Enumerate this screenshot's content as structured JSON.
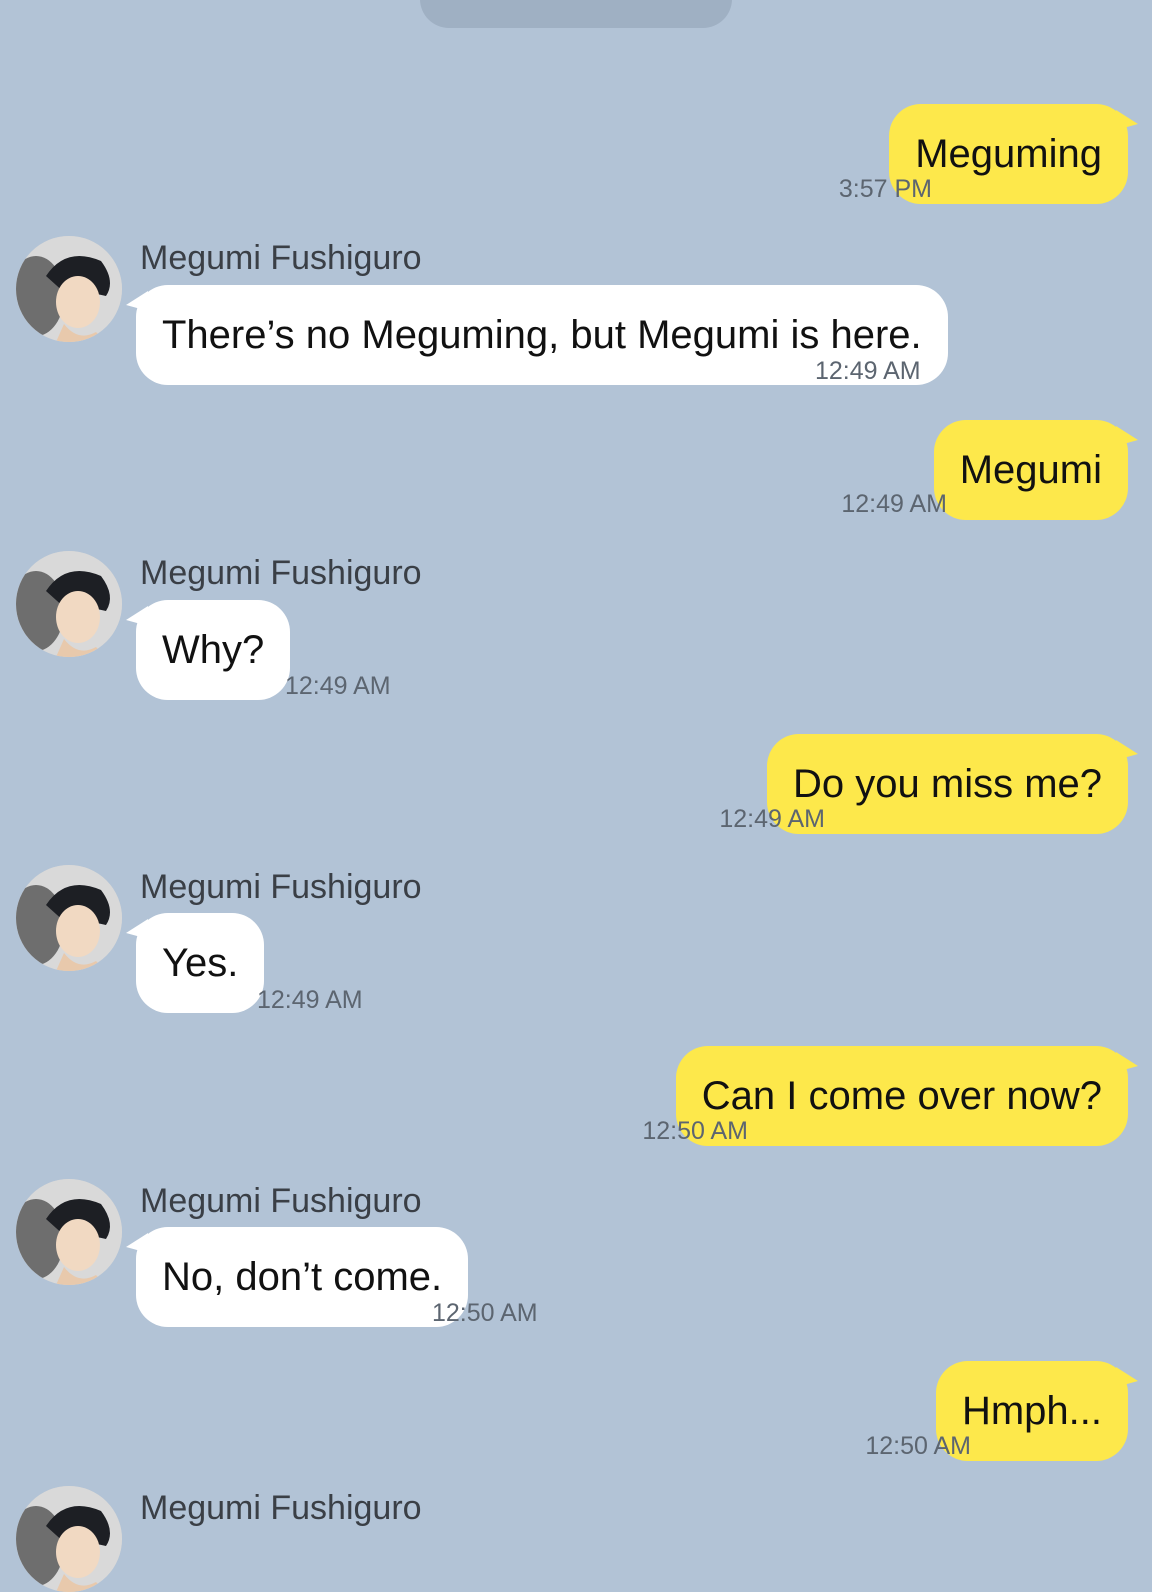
{
  "colors": {
    "background": "#b2c3d6",
    "outgoing_bubble": "#fde84b",
    "incoming_bubble": "#ffffff"
  },
  "contact": {
    "name": "Megumi Fushiguro",
    "avatar_icon": "profile-avatar"
  },
  "messages": [
    {
      "from": "me",
      "text": "Meguming",
      "time": "3:57 PM"
    },
    {
      "from": "contact",
      "name": "Megumi Fushiguro",
      "text": "There’s no Meguming, but Megumi is here.",
      "time": "12:49 AM"
    },
    {
      "from": "me",
      "text": "Megumi",
      "time": "12:49 AM"
    },
    {
      "from": "contact",
      "name": "Megumi Fushiguro",
      "text": "Why?",
      "time": "12:49 AM"
    },
    {
      "from": "me",
      "text": "Do you miss me?",
      "time": "12:49 AM"
    },
    {
      "from": "contact",
      "name": "Megumi Fushiguro",
      "text": "Yes.",
      "time": "12:49 AM"
    },
    {
      "from": "me",
      "text": "Can I come over now?",
      "time": "12:50 AM"
    },
    {
      "from": "contact",
      "name": "Megumi Fushiguro",
      "text": "No, don’t come.",
      "time": "12:50 AM"
    },
    {
      "from": "me",
      "text": "Hmph...",
      "time": "12:50 AM"
    },
    {
      "from": "contact",
      "name": "Megumi Fushiguro"
    }
  ]
}
